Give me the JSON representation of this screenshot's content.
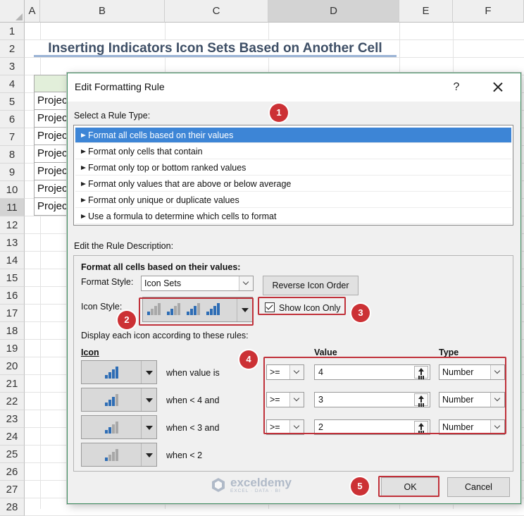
{
  "sheet": {
    "columns": [
      "A",
      "B",
      "C",
      "D",
      "E",
      "F"
    ],
    "selected_column": "D",
    "rows": [
      "1",
      "2",
      "3",
      "4",
      "5",
      "6",
      "7",
      "8",
      "9",
      "10",
      "11",
      "12",
      "13",
      "14",
      "15",
      "16",
      "17",
      "18",
      "19",
      "20",
      "21",
      "22",
      "23",
      "24",
      "25",
      "26",
      "27",
      "28"
    ],
    "selected_row": "11",
    "title": "Inserting Indicators Icon Sets Based on Another Cell",
    "table_cells": [
      "Projec",
      "Projec",
      "Projec",
      "Projec",
      "Projec",
      "Projec",
      "Projec"
    ]
  },
  "dialog": {
    "title": "Edit Formatting Rule",
    "help_label": "?",
    "select_rule_type_label": "Select a Rule Type:",
    "rule_types": [
      "Format all cells based on their values",
      "Format only cells that contain",
      "Format only top or bottom ranked values",
      "Format only values that are above or below average",
      "Format only unique or duplicate values",
      "Use a formula to determine which cells to format"
    ],
    "selected_rule_index": 0,
    "edit_description_label": "Edit the Rule Description:",
    "format_all_heading": "Format all cells based on their values:",
    "format_style_label": "Format Style:",
    "format_style_value": "Icon Sets",
    "reverse_icon_order_label": "Reverse Icon Order",
    "icon_style_label": "Icon Style:",
    "show_icon_only_label": "Show Icon Only",
    "show_icon_only_checked": true,
    "display_rules_label": "Display each icon according to these rules:",
    "col_icon": "Icon",
    "col_value": "Value",
    "col_type": "Type",
    "icon_rules": [
      {
        "icon": "signal-4-bars-icon",
        "condition": "when value is",
        "operator": ">=",
        "value": "4",
        "type": "Number"
      },
      {
        "icon": "signal-3-bars-icon",
        "condition": "when < 4 and",
        "operator": ">=",
        "value": "3",
        "type": "Number"
      },
      {
        "icon": "signal-2-bars-icon",
        "condition": "when < 3 and",
        "operator": ">=",
        "value": "2",
        "type": "Number"
      },
      {
        "icon": "signal-1-bar-icon",
        "condition": "when < 2"
      }
    ],
    "ok_label": "OK",
    "cancel_label": "Cancel"
  },
  "badges": [
    "1",
    "2",
    "3",
    "4",
    "5"
  ],
  "watermark": {
    "name": "exceldemy",
    "tagline": "EXCEL · DATA · BI"
  },
  "colors": {
    "bar_active": "#2e6db5",
    "bar_inactive": "#a8a8a8",
    "highlight": "#c0313a",
    "selection": "#3d85d6",
    "table_header": "#e2efda"
  }
}
